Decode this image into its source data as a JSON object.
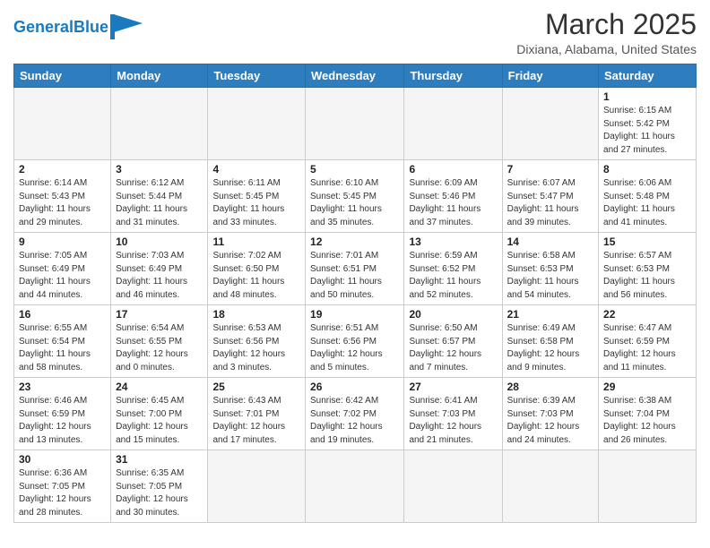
{
  "header": {
    "logo_general": "General",
    "logo_blue": "Blue",
    "month_title": "March 2025",
    "location": "Dixiana, Alabama, United States"
  },
  "weekdays": [
    "Sunday",
    "Monday",
    "Tuesday",
    "Wednesday",
    "Thursday",
    "Friday",
    "Saturday"
  ],
  "weeks": [
    [
      {
        "day": "",
        "info": ""
      },
      {
        "day": "",
        "info": ""
      },
      {
        "day": "",
        "info": ""
      },
      {
        "day": "",
        "info": ""
      },
      {
        "day": "",
        "info": ""
      },
      {
        "day": "",
        "info": ""
      },
      {
        "day": "1",
        "info": "Sunrise: 6:15 AM\nSunset: 5:42 PM\nDaylight: 11 hours\nand 27 minutes."
      }
    ],
    [
      {
        "day": "2",
        "info": "Sunrise: 6:14 AM\nSunset: 5:43 PM\nDaylight: 11 hours\nand 29 minutes."
      },
      {
        "day": "3",
        "info": "Sunrise: 6:12 AM\nSunset: 5:44 PM\nDaylight: 11 hours\nand 31 minutes."
      },
      {
        "day": "4",
        "info": "Sunrise: 6:11 AM\nSunset: 5:45 PM\nDaylight: 11 hours\nand 33 minutes."
      },
      {
        "day": "5",
        "info": "Sunrise: 6:10 AM\nSunset: 5:45 PM\nDaylight: 11 hours\nand 35 minutes."
      },
      {
        "day": "6",
        "info": "Sunrise: 6:09 AM\nSunset: 5:46 PM\nDaylight: 11 hours\nand 37 minutes."
      },
      {
        "day": "7",
        "info": "Sunrise: 6:07 AM\nSunset: 5:47 PM\nDaylight: 11 hours\nand 39 minutes."
      },
      {
        "day": "8",
        "info": "Sunrise: 6:06 AM\nSunset: 5:48 PM\nDaylight: 11 hours\nand 41 minutes."
      }
    ],
    [
      {
        "day": "9",
        "info": "Sunrise: 7:05 AM\nSunset: 6:49 PM\nDaylight: 11 hours\nand 44 minutes."
      },
      {
        "day": "10",
        "info": "Sunrise: 7:03 AM\nSunset: 6:49 PM\nDaylight: 11 hours\nand 46 minutes."
      },
      {
        "day": "11",
        "info": "Sunrise: 7:02 AM\nSunset: 6:50 PM\nDaylight: 11 hours\nand 48 minutes."
      },
      {
        "day": "12",
        "info": "Sunrise: 7:01 AM\nSunset: 6:51 PM\nDaylight: 11 hours\nand 50 minutes."
      },
      {
        "day": "13",
        "info": "Sunrise: 6:59 AM\nSunset: 6:52 PM\nDaylight: 11 hours\nand 52 minutes."
      },
      {
        "day": "14",
        "info": "Sunrise: 6:58 AM\nSunset: 6:53 PM\nDaylight: 11 hours\nand 54 minutes."
      },
      {
        "day": "15",
        "info": "Sunrise: 6:57 AM\nSunset: 6:53 PM\nDaylight: 11 hours\nand 56 minutes."
      }
    ],
    [
      {
        "day": "16",
        "info": "Sunrise: 6:55 AM\nSunset: 6:54 PM\nDaylight: 11 hours\nand 58 minutes."
      },
      {
        "day": "17",
        "info": "Sunrise: 6:54 AM\nSunset: 6:55 PM\nDaylight: 12 hours\nand 0 minutes."
      },
      {
        "day": "18",
        "info": "Sunrise: 6:53 AM\nSunset: 6:56 PM\nDaylight: 12 hours\nand 3 minutes."
      },
      {
        "day": "19",
        "info": "Sunrise: 6:51 AM\nSunset: 6:56 PM\nDaylight: 12 hours\nand 5 minutes."
      },
      {
        "day": "20",
        "info": "Sunrise: 6:50 AM\nSunset: 6:57 PM\nDaylight: 12 hours\nand 7 minutes."
      },
      {
        "day": "21",
        "info": "Sunrise: 6:49 AM\nSunset: 6:58 PM\nDaylight: 12 hours\nand 9 minutes."
      },
      {
        "day": "22",
        "info": "Sunrise: 6:47 AM\nSunset: 6:59 PM\nDaylight: 12 hours\nand 11 minutes."
      }
    ],
    [
      {
        "day": "23",
        "info": "Sunrise: 6:46 AM\nSunset: 6:59 PM\nDaylight: 12 hours\nand 13 minutes."
      },
      {
        "day": "24",
        "info": "Sunrise: 6:45 AM\nSunset: 7:00 PM\nDaylight: 12 hours\nand 15 minutes."
      },
      {
        "day": "25",
        "info": "Sunrise: 6:43 AM\nSunset: 7:01 PM\nDaylight: 12 hours\nand 17 minutes."
      },
      {
        "day": "26",
        "info": "Sunrise: 6:42 AM\nSunset: 7:02 PM\nDaylight: 12 hours\nand 19 minutes."
      },
      {
        "day": "27",
        "info": "Sunrise: 6:41 AM\nSunset: 7:03 PM\nDaylight: 12 hours\nand 21 minutes."
      },
      {
        "day": "28",
        "info": "Sunrise: 6:39 AM\nSunset: 7:03 PM\nDaylight: 12 hours\nand 24 minutes."
      },
      {
        "day": "29",
        "info": "Sunrise: 6:38 AM\nSunset: 7:04 PM\nDaylight: 12 hours\nand 26 minutes."
      }
    ],
    [
      {
        "day": "30",
        "info": "Sunrise: 6:36 AM\nSunset: 7:05 PM\nDaylight: 12 hours\nand 28 minutes."
      },
      {
        "day": "31",
        "info": "Sunrise: 6:35 AM\nSunset: 7:05 PM\nDaylight: 12 hours\nand 30 minutes."
      },
      {
        "day": "",
        "info": ""
      },
      {
        "day": "",
        "info": ""
      },
      {
        "day": "",
        "info": ""
      },
      {
        "day": "",
        "info": ""
      },
      {
        "day": "",
        "info": ""
      }
    ]
  ]
}
